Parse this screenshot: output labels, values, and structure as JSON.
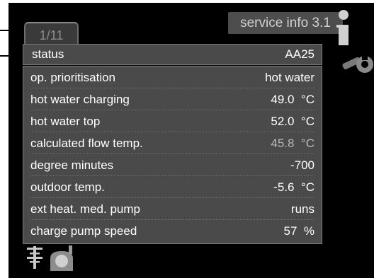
{
  "header": {
    "title": "service info 3.1",
    "page_indicator": "1/11"
  },
  "status": {
    "label": "status",
    "value": "AA25"
  },
  "rows": [
    {
      "label": "op. prioritisation",
      "value": "hot water"
    },
    {
      "label": "hot water charging",
      "value": "49.0  °C"
    },
    {
      "label": "hot water top",
      "value": "52.0  °C"
    },
    {
      "label": "calculated flow temp.",
      "value": "45.8  °C"
    },
    {
      "label": "degree minutes",
      "value": "-700"
    },
    {
      "label": "outdoor temp.",
      "value": "-5.6  °C"
    },
    {
      "label": "ext heat. med. pump",
      "value": "runs"
    },
    {
      "label": "charge pump speed",
      "value": "57  %"
    }
  ],
  "icons": {
    "info": "info-icon",
    "tools": "wrench-icon",
    "heating": "heating-icon",
    "hot_water": "hot-water-icon"
  },
  "colors": {
    "screen_bg": "#000000",
    "panel_bg": "#4a4a4a",
    "title_bg": "#4d4d4d",
    "text": "#ffffff"
  }
}
